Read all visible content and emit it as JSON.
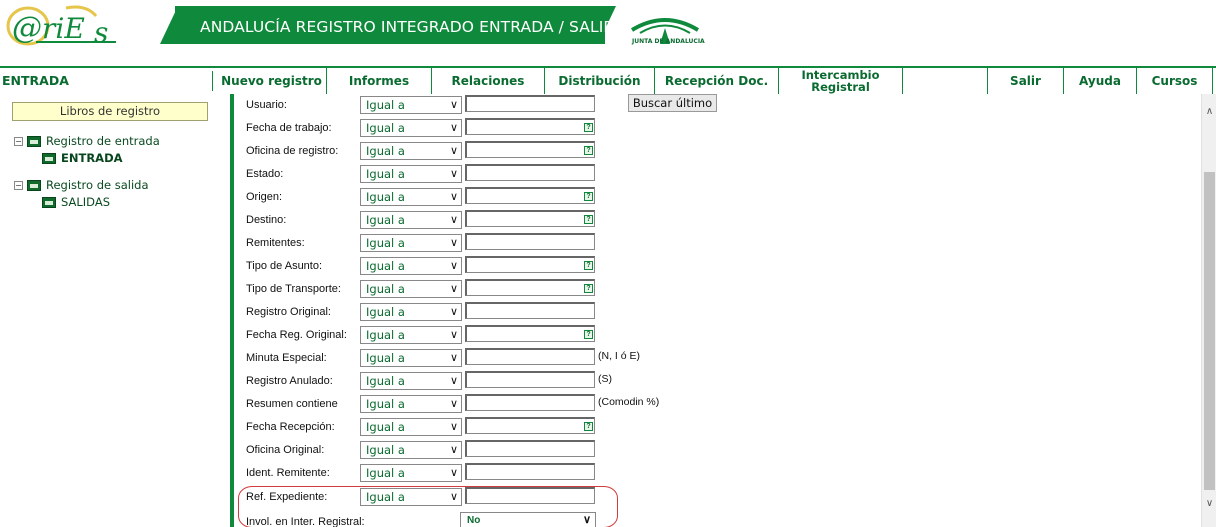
{
  "header": {
    "logo_text": "@riEs",
    "banner_title": "ANDALUCÍA REGISTRO INTEGRADO ENTRADA / SALIDA",
    "junta_text": "JUNTA DE ANDALUCIA",
    "colors": {
      "brand_green": "#0f8a3c",
      "logo_yellow": "#e5c64a"
    }
  },
  "nav": {
    "current": "ENTRADA",
    "items": [
      {
        "label": "Nuevo registro"
      },
      {
        "label": "Informes"
      },
      {
        "label": "Relaciones"
      },
      {
        "label": "Distribución"
      },
      {
        "label": "Recepción Doc."
      },
      {
        "label": "Intercambio Registral"
      },
      {
        "label": ""
      },
      {
        "label": "Salir"
      },
      {
        "label": "Ayuda"
      },
      {
        "label": "Cursos"
      }
    ]
  },
  "sidebar": {
    "libros_button": "Libros de registro",
    "tree": [
      {
        "label": "Registro de entrada",
        "toggle": "−",
        "child": "ENTRADA"
      },
      {
        "label": "Registro de salida",
        "toggle": "−",
        "child": "SALIDAS"
      }
    ]
  },
  "form": {
    "operator_default": "Igual a",
    "buscar_button": "Buscar último",
    "help_glyph": "?",
    "fields": [
      {
        "label": "Usuario:"
      },
      {
        "label": "Fecha de trabajo:",
        "help": true
      },
      {
        "label": "Oficina de registro:",
        "help": true
      },
      {
        "label": "Estado:"
      },
      {
        "label": "Origen:",
        "help": true
      },
      {
        "label": "Destino:",
        "help": true
      },
      {
        "label": "Remitentes:"
      },
      {
        "label": "Tipo de Asunto:",
        "help": true
      },
      {
        "label": "Tipo de Transporte:",
        "help": true
      },
      {
        "label": "Registro Original:"
      },
      {
        "label": "Fecha Reg. Original:",
        "help": true
      },
      {
        "label": "Minuta Especial:",
        "hint": "(N, I ó E)"
      },
      {
        "label": "Registro Anulado:",
        "hint": "(S)"
      },
      {
        "label": "Resumen contiene",
        "hint": "(Comodin %)"
      },
      {
        "label": "Fecha Recepción:",
        "help": true
      },
      {
        "label": "Oficina Original:"
      },
      {
        "label": "Ident. Remitente:"
      },
      {
        "label": "Ref. Expediente:"
      }
    ],
    "involucrado": {
      "label": "Invol. en Inter. Registral:",
      "value": "No"
    }
  }
}
